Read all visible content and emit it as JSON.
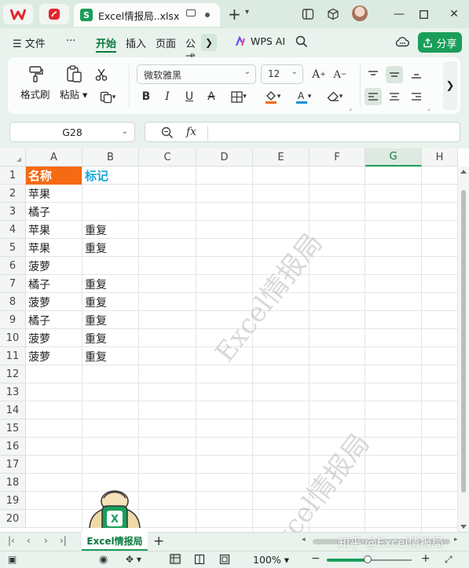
{
  "titlebar": {
    "file_tab": "Excel情报局..xlsx",
    "file_badge": "S"
  },
  "menu": {
    "items": [
      "文件",
      "开始",
      "插入",
      "页面",
      "公式"
    ],
    "active": "开始",
    "more": "···",
    "ai_label": "WPS AI",
    "share_label": "分享"
  },
  "ribbon": {
    "format_painter": "格式刷",
    "paste": "粘贴",
    "font_name": "微软雅黑",
    "font_size": "12"
  },
  "formula_bar": {
    "cell_ref": "G28",
    "fx": "fx",
    "value": ""
  },
  "sheet": {
    "columns": [
      "A",
      "B",
      "C",
      "D",
      "E",
      "F",
      "G",
      "H"
    ],
    "selected_column": "G",
    "rows": [
      "1",
      "2",
      "3",
      "4",
      "5",
      "6",
      "7",
      "8",
      "9",
      "10",
      "11",
      "12",
      "13",
      "14",
      "15",
      "16",
      "17",
      "18",
      "19",
      "20"
    ],
    "data": [
      [
        "名称",
        "标记"
      ],
      [
        "苹果",
        ""
      ],
      [
        "橘子",
        ""
      ],
      [
        "苹果",
        "重复"
      ],
      [
        "苹果",
        "重复"
      ],
      [
        "菠萝",
        ""
      ],
      [
        "橘子",
        "重复"
      ],
      [
        "菠萝",
        "重复"
      ],
      [
        "橘子",
        "重复"
      ],
      [
        "菠萝",
        "重复"
      ],
      [
        "菠萝",
        "重复"
      ]
    ],
    "watermark": "Excel情报局",
    "mascot_badge": "X"
  },
  "sheet_tabs": {
    "tabs": [
      "Excel情报局"
    ],
    "add": "+",
    "credit": "知乎 @Excel情报局"
  },
  "status": {
    "zoom": "100%",
    "zoom_level": 0.48
  },
  "colors": {
    "accent": "#1a9e5a",
    "header_a_bg": "#f56a12",
    "header_b_text": "#1aa5d8"
  }
}
